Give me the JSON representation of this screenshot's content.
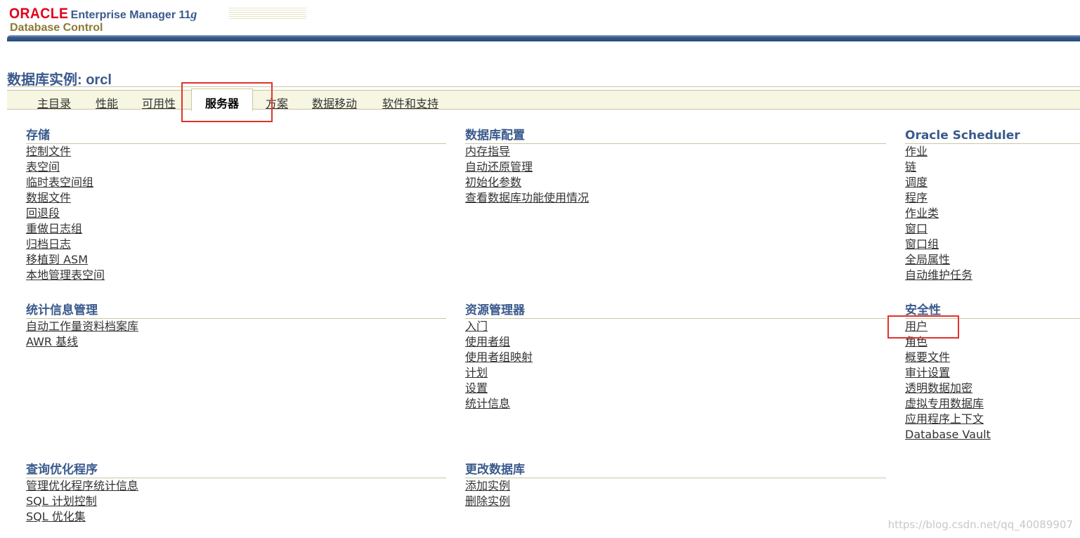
{
  "header": {
    "oracle": "ORACLE",
    "product": "Enterprise Manager 11",
    "version_g": "g",
    "subtitle": "Database Control"
  },
  "page_title": "数据库实例: orcl",
  "tabs": {
    "items": [
      "主目录",
      "性能",
      "可用性",
      "服务器",
      "方案",
      "数据移动",
      "软件和支持"
    ],
    "active": "服务器"
  },
  "sections": {
    "storage": {
      "title": "存储",
      "links": [
        "控制文件",
        "表空间",
        "临时表空间组",
        "数据文件",
        "回退段",
        "重做日志组",
        "归档日志",
        "移植到 ASM",
        "本地管理表空间"
      ]
    },
    "db_config": {
      "title": "数据库配置",
      "links": [
        "内存指导",
        "自动还原管理",
        "初始化参数",
        "查看数据库功能使用情况"
      ]
    },
    "scheduler": {
      "title": "Oracle Scheduler",
      "links": [
        "作业",
        "链",
        "调度",
        "程序",
        "作业类",
        "窗口",
        "窗口组",
        "全局属性",
        "自动维护任务"
      ]
    },
    "stats": {
      "title": "统计信息管理",
      "links": [
        "自动工作量资料档案库",
        "AWR 基线"
      ]
    },
    "resource": {
      "title": "资源管理器",
      "links": [
        "入门",
        "使用者组",
        "使用者组映射",
        "计划",
        "设置",
        "统计信息"
      ]
    },
    "security": {
      "title": "安全性",
      "links": [
        "用户",
        "角色",
        "概要文件",
        "审计设置",
        "透明数据加密",
        "虚拟专用数据库",
        "应用程序上下文",
        "Database Vault"
      ]
    },
    "optimizer": {
      "title": "查询优化程序",
      "links": [
        "管理优化程序统计信息",
        "SQL 计划控制",
        "SQL 优化集"
      ]
    },
    "change_db": {
      "title": "更改数据库",
      "links": [
        "添加实例",
        "删除实例"
      ]
    }
  },
  "watermark": "https://blog.csdn.net/qq_40089907",
  "colors": {
    "accent": "#3a5a8c",
    "oracle_red": "#e3001b",
    "highlight": "#e0332d"
  }
}
